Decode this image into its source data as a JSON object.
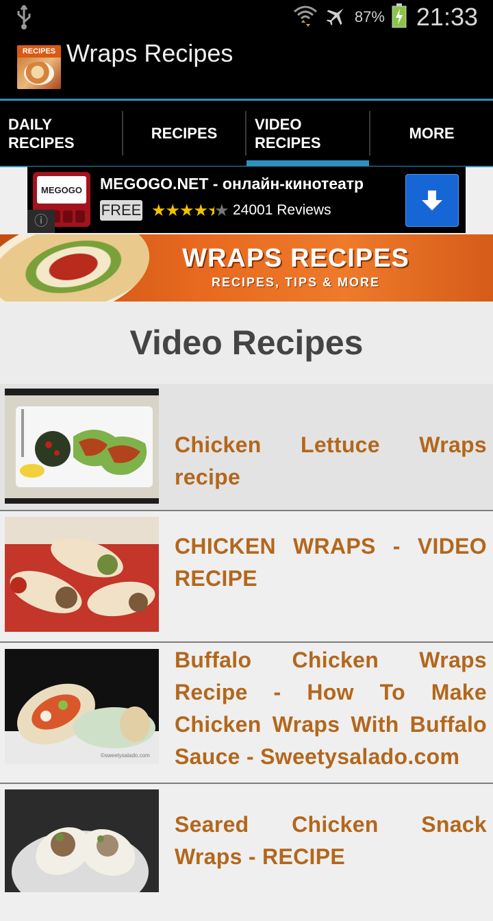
{
  "status_bar": {
    "battery_percent": "87%",
    "time": "21:33",
    "icons": [
      "usb-icon",
      "wifi-icon",
      "airplane-icon",
      "battery-charging-icon"
    ]
  },
  "app": {
    "title": "Wraps Recipes",
    "icon_badge": "RECIPES"
  },
  "tabs": [
    {
      "label": "DAILY\nRECIPES",
      "selected": false
    },
    {
      "label": "RECIPES",
      "selected": false
    },
    {
      "label": "VIDEO\nRECIPES",
      "selected": true
    },
    {
      "label": "MORE",
      "selected": false
    }
  ],
  "ad": {
    "logo_text": "MEGOGO",
    "title": "MEGOGO.NET - онлайн-кинотеатр",
    "price": "FREE",
    "rating_stars": 4.5,
    "reviews": "24001 Reviews",
    "info_icon": "info-icon",
    "download_icon": "download-arrow-icon"
  },
  "banner": {
    "title": "WRAPS RECIPES",
    "subtitle": "RECIPES, TIPS & MORE"
  },
  "page_title": "Video Recipes",
  "items": [
    {
      "title": "Chicken Lettuce Wraps recipe"
    },
    {
      "title": "CHICKEN WRAPS - VIDEO RECIPE"
    },
    {
      "title": "Buffalo Chicken Wraps Recipe - How To Make Chicken Wraps With Buffalo Sauce - Sweetysalado.com"
    },
    {
      "title": "Seared Chicken Snack Wraps - RECIPE"
    }
  ],
  "colors": {
    "accent": "#2f8fbf",
    "item_title": "#b3671c",
    "ad_button": "#1766d6"
  }
}
